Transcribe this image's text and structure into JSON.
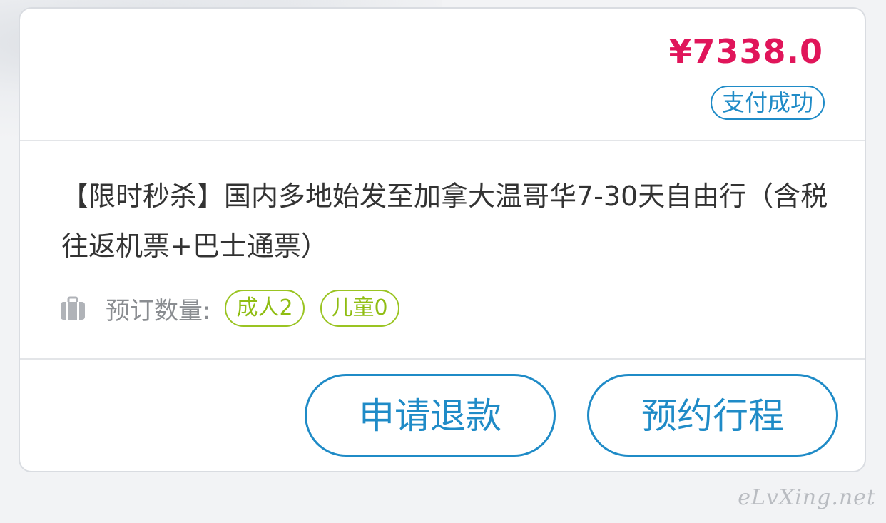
{
  "order": {
    "price": "¥7338.0",
    "status": "支付成功",
    "title": "【限时秒杀】国内多地始发至加拿大温哥华7-30天自由行（含税往返机票+巴士通票）",
    "quantity_label": "预订数量:",
    "adult_tag": "成人2",
    "child_tag": "儿童0"
  },
  "actions": {
    "refund_label": "申请退款",
    "book_label": "预约行程"
  },
  "watermark": "eLvXing.net",
  "icons": {
    "quantity": "luggage-icon"
  },
  "colors": {
    "price": "#e0155a",
    "accent": "#1f8bc7",
    "tag": "#9ac422"
  }
}
